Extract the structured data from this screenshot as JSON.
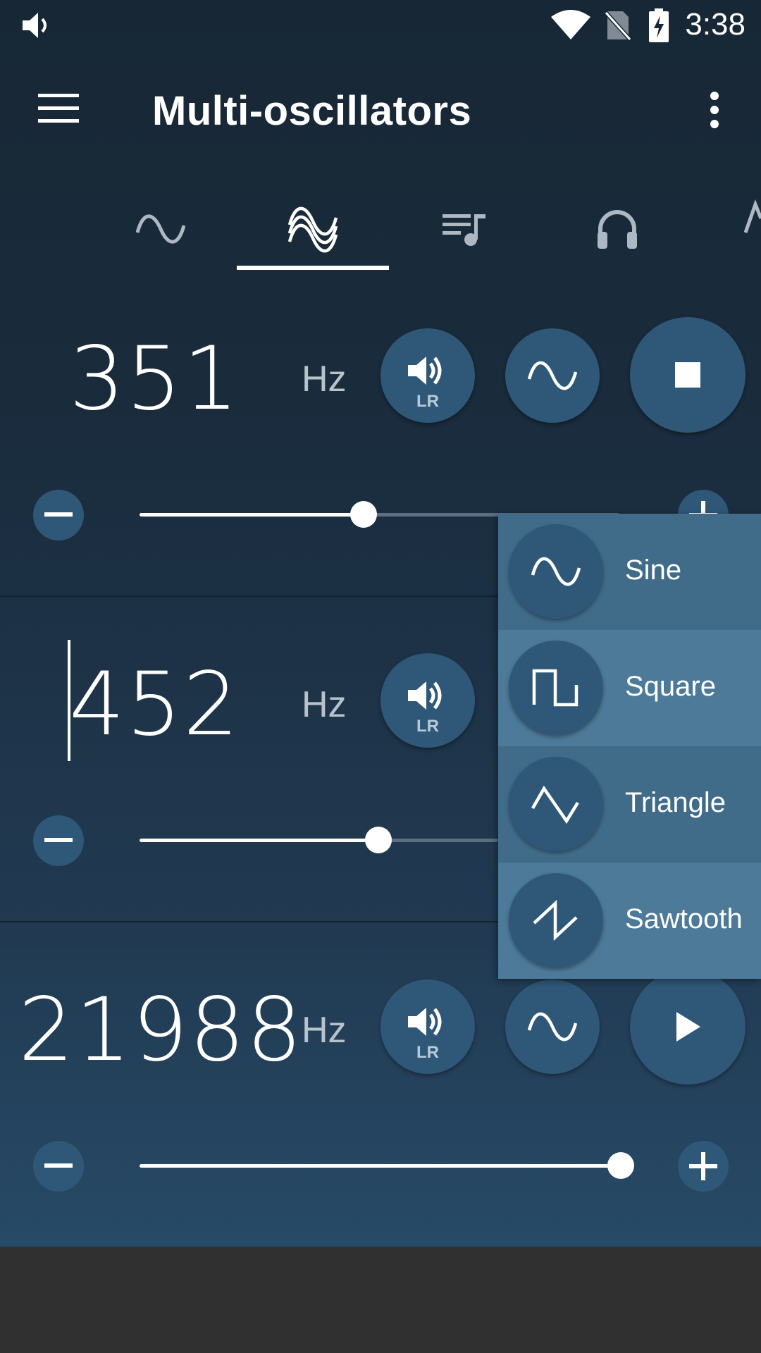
{
  "status": {
    "time": "3:38"
  },
  "toolbar": {
    "title": "Multi-oscillators"
  },
  "tabs": [
    {
      "icon": "sine-wave-icon"
    },
    {
      "icon": "multi-wave-icon",
      "selected": true
    },
    {
      "icon": "playlist-icon"
    },
    {
      "icon": "headphones-icon"
    },
    {
      "icon": "wave-partial-icon"
    }
  ],
  "oscillators": [
    {
      "frequency": "351",
      "unit": "Hz",
      "channel": "LR",
      "waveform": "sine",
      "state": "stop",
      "slider_fraction": 0.47
    },
    {
      "frequency": "452",
      "unit": "Hz",
      "channel": "LR",
      "waveform": "sine",
      "state": "stop",
      "slider_fraction": 0.5
    },
    {
      "frequency": "21988",
      "unit": "Hz",
      "channel": "LR",
      "waveform": "sine",
      "state": "play",
      "slider_fraction": 1.0
    }
  ],
  "waveform_menu": [
    {
      "label": "Sine",
      "icon": "sine-wave-icon"
    },
    {
      "label": "Square",
      "icon": "square-wave-icon"
    },
    {
      "label": "Triangle",
      "icon": "triangle-wave-icon"
    },
    {
      "label": "Sawtooth",
      "icon": "sawtooth-wave-icon"
    }
  ],
  "colors": {
    "accent": "#2f5878",
    "background_top": "#172735",
    "background_bottom": "#274a66",
    "menu_item_dark": "#406c8a",
    "menu_item_light": "#4d7a99"
  }
}
